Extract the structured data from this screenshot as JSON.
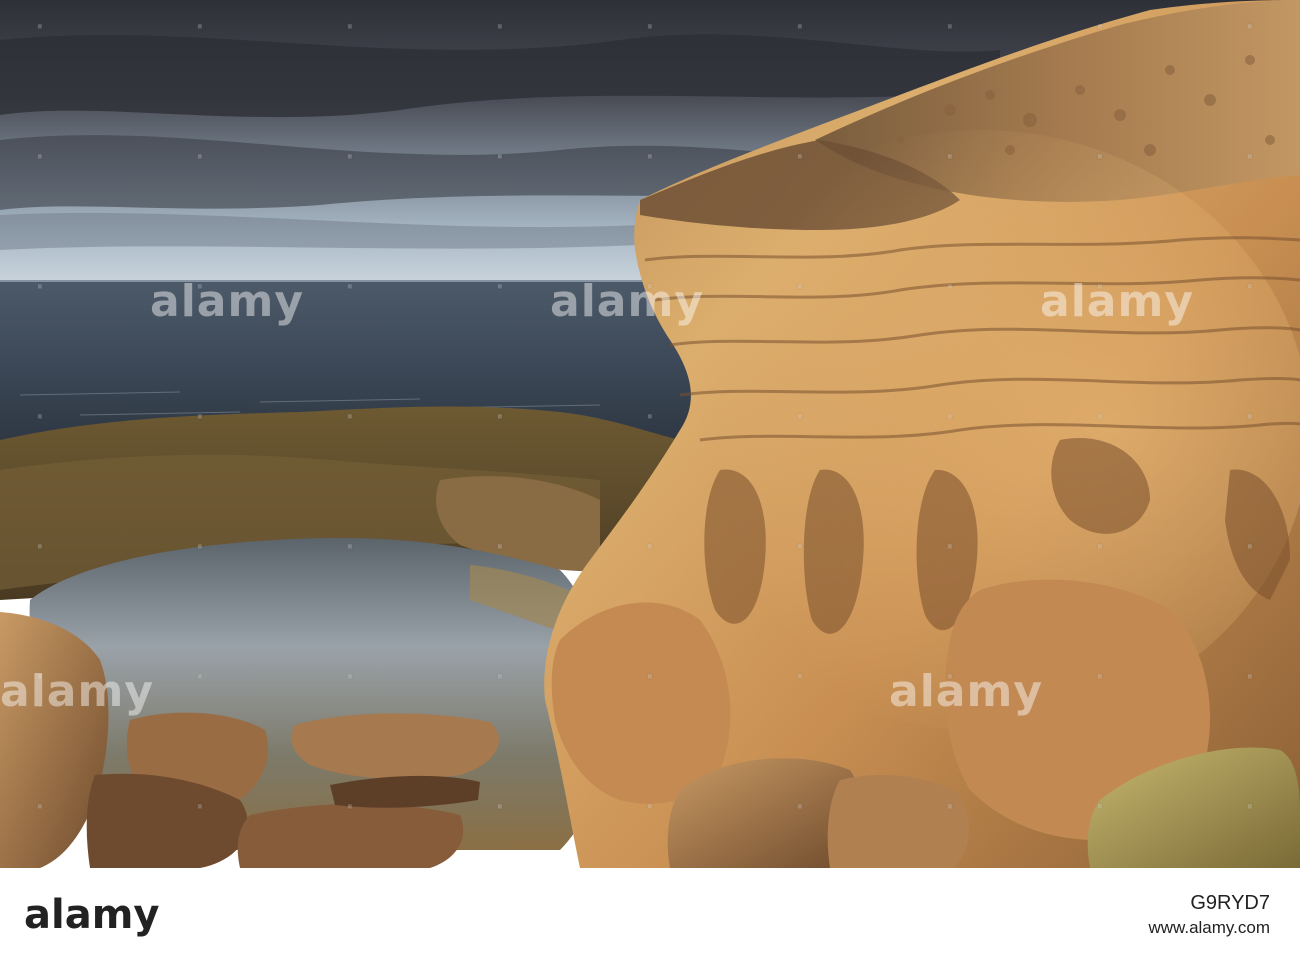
{
  "watermark": {
    "text": "alamy",
    "center_text": "alamy"
  },
  "footer": {
    "logo": "alamy",
    "image_id": "G9RYD7",
    "site": "www.alamy.com"
  },
  "colors": {
    "sky_top": "#3a3c44",
    "sky_horizon": "#bcc8d2",
    "sea": "#3f4c5c",
    "rock_lit": "#d9a15a",
    "rock_shadow": "#6b4a2c",
    "pool": "#8d949a"
  }
}
